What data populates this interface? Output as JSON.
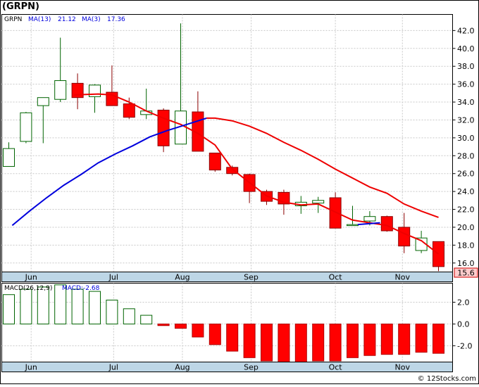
{
  "title": "(GRPN)",
  "footer": "© 12Stocks.com",
  "colors": {
    "up_fill": "#ffffff",
    "up_stroke": "#006400",
    "down_fill": "#ff0000",
    "down_stroke": "#8b0000",
    "ma_fast": "#0000dd",
    "ma_slow": "#ee0000",
    "macd_bar_pos_stroke": "#006400",
    "macd_bar_neg": "#ff0000",
    "axis_band": "#bdd6e6",
    "last_price_bg": "#ffcccc",
    "grid": "#c8c8c8"
  },
  "chart_data": [
    {
      "type": "candlestick",
      "name": "price",
      "ylim": [
        15.0,
        43.8
      ],
      "yticks": [
        "16.0",
        "18.0",
        "20.0",
        "22.0",
        "24.0",
        "26.0",
        "28.0",
        "30.0",
        "32.0",
        "34.0",
        "36.0",
        "38.0",
        "40.0",
        "42.0"
      ],
      "ytick_values": [
        16,
        18,
        20,
        22,
        24,
        26,
        28,
        30,
        32,
        34,
        36,
        38,
        40,
        42
      ],
      "month_labels": [
        "Jun",
        "Jul",
        "Aug",
        "Sep",
        "Oct",
        "Nov"
      ],
      "month_positions": [
        1.3,
        6.1,
        10.1,
        14.1,
        19.0,
        22.9
      ],
      "last_price_label": "15.6",
      "legend": {
        "symbol": "GRPN",
        "ma13_label": "MA(13)",
        "ma13_value": "21.12",
        "ma3_label": "MA(3)",
        "ma3_value": "17.36"
      },
      "candles": [
        {
          "o": 26.8,
          "h": 29.5,
          "l": 26.8,
          "c": 28.8
        },
        {
          "o": 29.6,
          "h": 32.9,
          "l": 29.4,
          "c": 32.8
        },
        {
          "o": 33.6,
          "h": 34.3,
          "l": 29.4,
          "c": 34.5
        },
        {
          "o": 34.3,
          "h": 41.2,
          "l": 34.0,
          "c": 36.4
        },
        {
          "o": 36.1,
          "h": 37.2,
          "l": 33.2,
          "c": 34.5
        },
        {
          "o": 34.6,
          "h": 36.0,
          "l": 32.8,
          "c": 35.9
        },
        {
          "o": 35.1,
          "h": 38.1,
          "l": 33.6,
          "c": 33.6
        },
        {
          "o": 33.8,
          "h": 34.5,
          "l": 32.1,
          "c": 32.3
        },
        {
          "o": 32.6,
          "h": 35.5,
          "l": 32.1,
          "c": 33.0
        },
        {
          "o": 33.1,
          "h": 33.3,
          "l": 28.4,
          "c": 29.1
        },
        {
          "o": 29.3,
          "h": 42.8,
          "l": 29.3,
          "c": 33.0
        },
        {
          "o": 32.9,
          "h": 35.2,
          "l": 28.5,
          "c": 28.5
        },
        {
          "o": 28.3,
          "h": 28.3,
          "l": 26.2,
          "c": 26.4
        },
        {
          "o": 26.7,
          "h": 26.9,
          "l": 25.8,
          "c": 26.0
        },
        {
          "o": 25.9,
          "h": 26.0,
          "l": 22.7,
          "c": 24.0
        },
        {
          "o": 24.0,
          "h": 24.2,
          "l": 22.5,
          "c": 22.9
        },
        {
          "o": 23.9,
          "h": 24.2,
          "l": 21.4,
          "c": 22.6
        },
        {
          "o": 22.4,
          "h": 23.5,
          "l": 21.5,
          "c": 22.8
        },
        {
          "o": 22.7,
          "h": 23.4,
          "l": 21.6,
          "c": 23.0
        },
        {
          "o": 23.3,
          "h": 23.9,
          "l": 19.9,
          "c": 19.9
        },
        {
          "o": 20.3,
          "h": 22.4,
          "l": 20.2,
          "c": 20.3
        },
        {
          "o": 20.7,
          "h": 21.8,
          "l": 20.2,
          "c": 21.2
        },
        {
          "o": 21.2,
          "h": 21.3,
          "l": 19.5,
          "c": 19.6
        },
        {
          "o": 20.0,
          "h": 21.6,
          "l": 17.1,
          "c": 17.9
        },
        {
          "o": 17.4,
          "h": 19.6,
          "l": 17.1,
          "c": 18.8
        },
        {
          "o": 18.4,
          "h": 18.4,
          "l": 15.1,
          "c": 15.6
        }
      ],
      "ma_slow": [
        null,
        null,
        null,
        null,
        null,
        null,
        null,
        null,
        null,
        null,
        null,
        32.2,
        32.2,
        31.9,
        31.3,
        30.5,
        29.5,
        28.6,
        27.6,
        26.5,
        25.5,
        24.5,
        23.8,
        22.6,
        21.8,
        21.1
      ],
      "ma_slow_x_start": 11.5,
      "ma_fast": [
        20.2,
        21.8,
        23.3,
        24.7,
        25.9,
        27.2,
        28.2,
        29.1,
        30.1,
        30.8,
        31.4,
        32.2
      ],
      "ma_fast_x": [
        0.2,
        1.2,
        2.2,
        3.2,
        4.2,
        5.2,
        6.2,
        7.2,
        8.2,
        9.2,
        10.2,
        11.5
      ],
      "ma_fast_tail": [
        [
          20.3,
          20.3
        ],
        [
          21.6,
          20.5
        ]
      ],
      "price_red_overlay": [
        [
          3.8,
          34.8
        ],
        [
          5.2,
          34.9
        ],
        [
          6.0,
          34.8
        ],
        [
          7.0,
          34.0
        ],
        [
          8.0,
          33.0
        ],
        [
          9.0,
          32.2
        ],
        [
          10.0,
          31.5
        ],
        [
          11.0,
          30.5
        ],
        [
          12.0,
          29.2
        ],
        [
          13.0,
          26.5
        ],
        [
          14.0,
          25.0
        ],
        [
          15.0,
          23.5
        ],
        [
          16.0,
          22.8
        ],
        [
          17.0,
          22.5
        ],
        [
          18.0,
          22.6
        ],
        [
          19.0,
          21.7
        ],
        [
          20.0,
          20.8
        ],
        [
          21.0,
          20.5
        ],
        [
          22.0,
          20.2
        ],
        [
          23.0,
          19.3
        ],
        [
          24.0,
          18.5
        ],
        [
          25.0,
          17.0
        ]
      ]
    },
    {
      "type": "bar",
      "name": "macd",
      "legend_label": "MACD(26,12,9)",
      "legend_value": "MACD:-2.68",
      "ylim": [
        -3.5,
        3.75
      ],
      "yticks": [
        "2.0",
        "0.0",
        "-2.0"
      ],
      "ytick_values": [
        2,
        0,
        -2
      ],
      "month_labels": [
        "Jun",
        "Jul",
        "Aug",
        "Sep",
        "Oct",
        "Nov"
      ],
      "values": [
        2.7,
        3.2,
        3.4,
        3.6,
        3.2,
        3.0,
        2.2,
        1.4,
        0.8,
        -0.15,
        -0.4,
        -1.2,
        -1.9,
        -2.5,
        -3.1,
        -3.4,
        -3.5,
        -3.5,
        -3.4,
        -3.4,
        -3.1,
        -2.9,
        -2.8,
        -2.8,
        -2.6,
        -2.7
      ]
    }
  ]
}
